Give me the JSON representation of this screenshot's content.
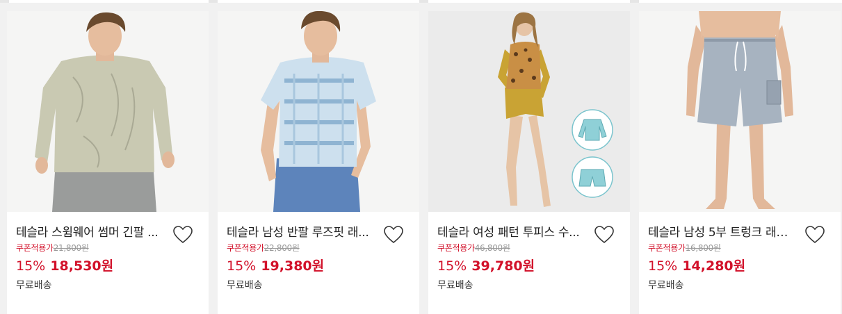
{
  "products": [
    {
      "title": "테슬라 스윔웨어 썸머 긴팔 ...",
      "coupon_label": "쿠폰적용가",
      "original_price": "21,800원",
      "discount": "15%",
      "price": "18,530원",
      "shipping": "무료배송",
      "image": "man-longsleeve-rashguard"
    },
    {
      "title": "테슬라 남성 반팔 루즈핏 래...",
      "coupon_label": "쿠폰적용가",
      "original_price": "22,800원",
      "discount": "15%",
      "price": "19,380원",
      "shipping": "무료배송",
      "image": "man-shortsleeve-printed-tee"
    },
    {
      "title": "테슬라 여성 패턴 투피스 수...",
      "coupon_label": "쿠폰적용가",
      "original_price": "46,800원",
      "discount": "15%",
      "price": "39,780원",
      "shipping": "무료배송",
      "image": "woman-leopard-twopiece-swimsuit"
    },
    {
      "title": "테슬라 남성 5부 트렁크 래쉬...",
      "coupon_label": "쿠폰적용가",
      "original_price": "16,800원",
      "discount": "15%",
      "price": "14,280원",
      "shipping": "무료배송",
      "image": "man-grey-board-shorts"
    }
  ],
  "colors": {
    "accent": "#d2112a",
    "background": "#f1f1f1",
    "card": "#ffffff"
  },
  "icons": [
    "heart-icon"
  ]
}
